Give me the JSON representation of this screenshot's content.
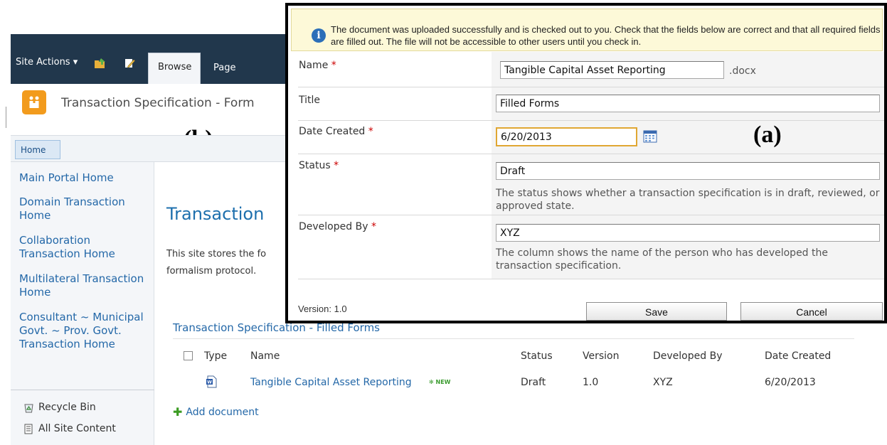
{
  "ribbon": {
    "site_actions": "Site Actions ▾",
    "tab_browse": "Browse",
    "tab_page": "Page"
  },
  "site": {
    "title": "Transaction Specification - Form",
    "label_b": "(b)",
    "nav_home": "Home"
  },
  "quick_launch": {
    "links": [
      {
        "label": "Main Portal Home"
      },
      {
        "label": "Domain Transaction Home"
      },
      {
        "label": "Collaboration Transaction Home"
      },
      {
        "label": "Multilateral Transaction Home"
      },
      {
        "label": "Consultant ~ Municipal Govt. ~ Prov. Govt. Transaction Home"
      }
    ],
    "recycle_bin": "Recycle Bin",
    "all_site_content": "All Site Content"
  },
  "main": {
    "heading": "Transaction",
    "description": "This site stores the fo formalism protocol."
  },
  "library": {
    "title": "Transaction Specification - Filled Forms",
    "columns": [
      "Type",
      "Name",
      "Status",
      "Version",
      "Developed By",
      "Date Created"
    ],
    "rows": [
      {
        "name": "Tangible Capital Asset Reporting",
        "new_badge": "NEW",
        "status": "Draft",
        "version": "1.0",
        "developed_by": "XYZ",
        "date_created": "6/20/2013"
      }
    ],
    "add_document": "Add document"
  },
  "dialog": {
    "label_a": "(a)",
    "notice": "The document was uploaded successfully and is checked out to you. Check that the fields below are correct and that all required fields are filled out. The file will not be accessible to other users until you check in.",
    "fields": {
      "name": {
        "label": "Name",
        "required": "*",
        "value": "Tangible Capital Asset Reporting",
        "extension": ".docx"
      },
      "title": {
        "label": "Title",
        "value": "Filled Forms"
      },
      "date_created": {
        "label": "Date Created",
        "required": "*",
        "value": "6/20/2013"
      },
      "status": {
        "label": "Status",
        "required": "*",
        "value": "Draft",
        "description": "The status shows whether a transaction specification is in draft, reviewed, or approved state."
      },
      "developed_by": {
        "label": "Developed By",
        "required": "*",
        "value": "XYZ",
        "description": "The column shows the name of the person who has developed the transaction specification."
      }
    },
    "version": "Version: 1.0",
    "save": "Save",
    "cancel": "Cancel"
  }
}
